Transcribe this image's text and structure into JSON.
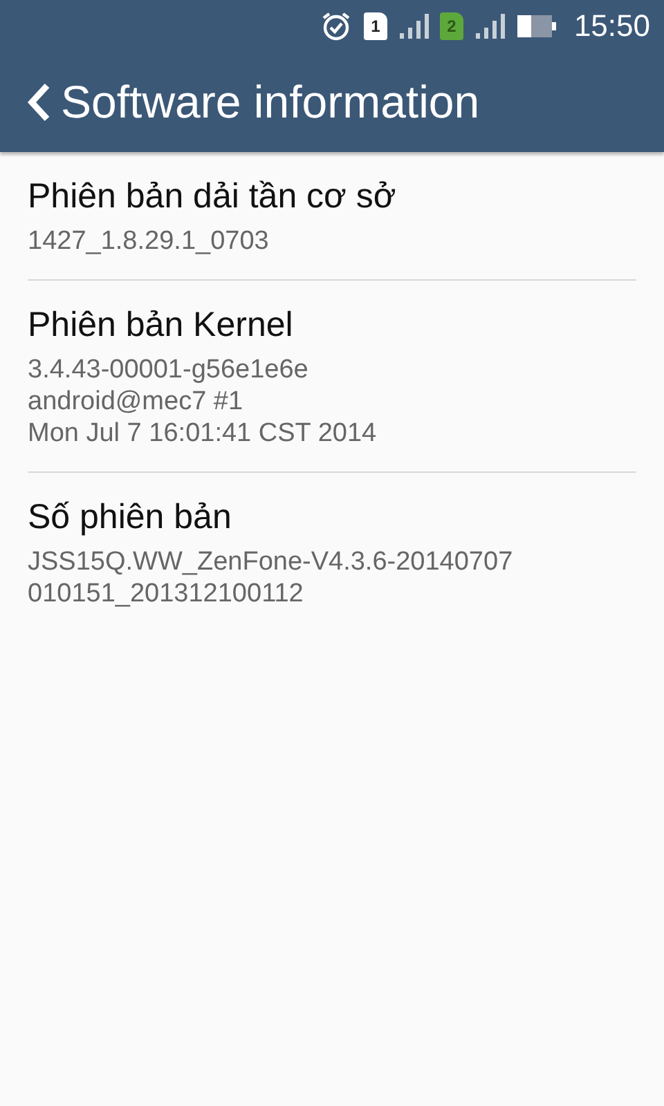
{
  "status_bar": {
    "sim_slots": [
      {
        "label": "1",
        "active": false
      },
      {
        "label": "2",
        "active": true
      }
    ],
    "time": "15:50"
  },
  "app_bar": {
    "title": "Software information"
  },
  "items": [
    {
      "title": "Phiên bản dải tần cơ sở",
      "lines": [
        "1427_1.8.29.1_0703"
      ]
    },
    {
      "title": "Phiên bản Kernel",
      "lines": [
        "3.4.43-00001-g56e1e6e",
        "android@mec7 #1",
        "Mon Jul 7 16:01:41 CST 2014"
      ]
    },
    {
      "title": "Số phiên bản",
      "lines": [
        "JSS15Q.WW_ZenFone-V4.3.6-20140707",
        "010151_201312100112"
      ]
    }
  ]
}
